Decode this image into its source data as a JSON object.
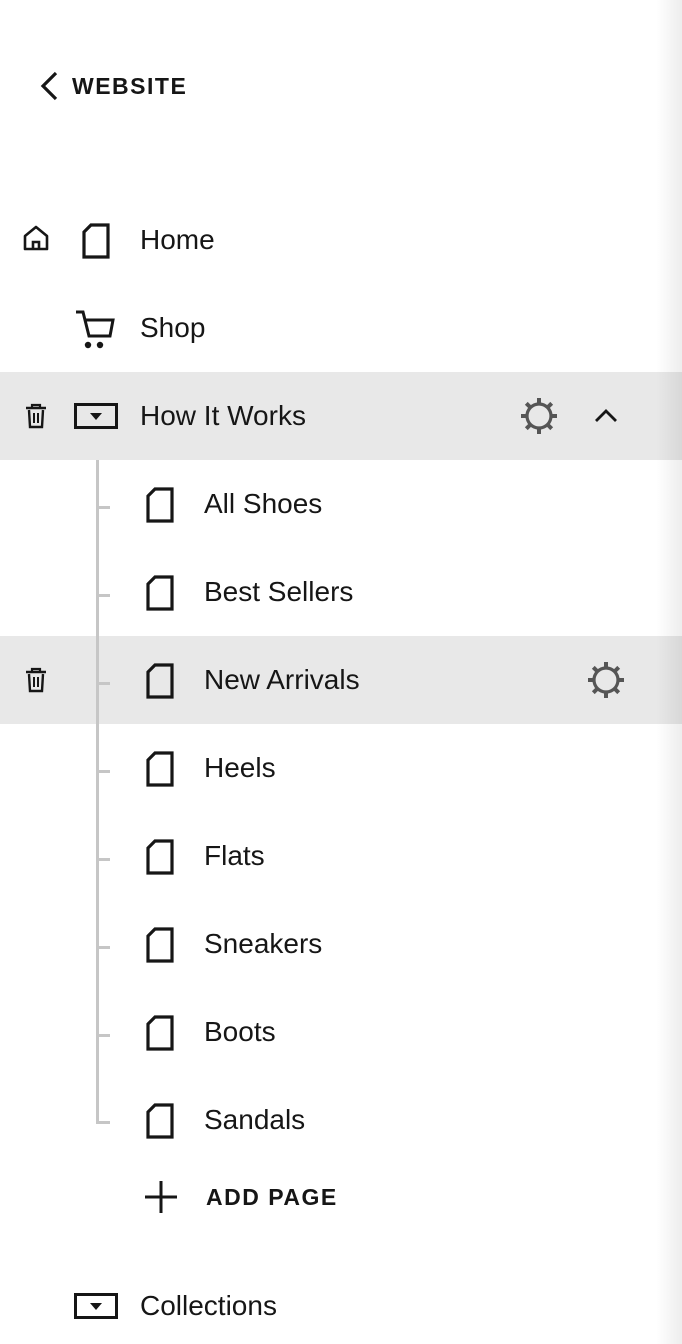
{
  "header": {
    "back_label": "WEBSITE",
    "back_icon": "chevron-left-icon"
  },
  "pages": [
    {
      "label": "Home",
      "icon": "page-icon",
      "is_homepage": true
    },
    {
      "label": "Shop",
      "icon": "cart-icon"
    },
    {
      "label": "How It Works",
      "icon": "folder-icon",
      "selected": true,
      "expanded": true
    }
  ],
  "folder_children": [
    {
      "label": "All Shoes",
      "icon": "page-icon"
    },
    {
      "label": "Best Sellers",
      "icon": "page-icon"
    },
    {
      "label": "New Arrivals",
      "icon": "page-icon",
      "hovered": true
    },
    {
      "label": "Heels",
      "icon": "page-icon"
    },
    {
      "label": "Flats",
      "icon": "page-icon"
    },
    {
      "label": "Sneakers",
      "icon": "page-icon"
    },
    {
      "label": "Boots",
      "icon": "page-icon"
    },
    {
      "label": "Sandals",
      "icon": "page-icon"
    }
  ],
  "add_page": {
    "label": "ADD PAGE",
    "icon": "plus-icon"
  },
  "bottom": {
    "label": "Collections",
    "icon": "folder-icon"
  },
  "colors": {
    "highlight": "#e8e8e8",
    "text": "#161616",
    "icon_gray": "#555555",
    "tree_line": "#c6c6c6"
  }
}
